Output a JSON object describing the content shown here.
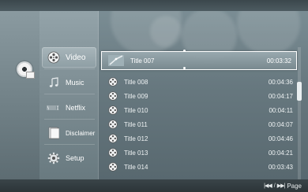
{
  "menu": {
    "items": [
      {
        "label": "Video",
        "icon": "film-reel-icon",
        "active": true
      },
      {
        "label": "Music",
        "icon": "music-note-icon",
        "active": false
      },
      {
        "label": "Netflix",
        "icon": "netflix-logo-icon",
        "active": false
      },
      {
        "label": "Disclaimer",
        "icon": "document-icon",
        "active": false
      },
      {
        "label": "Setup",
        "icon": "gear-icon",
        "active": false
      }
    ]
  },
  "device": {
    "icon": "disc-icon"
  },
  "titles": {
    "selected": {
      "title": "Title 007",
      "time": "00:03:32"
    },
    "rows": [
      {
        "title": "Title 008",
        "time": "00:04:36"
      },
      {
        "title": "Title 009",
        "time": "00:04:17"
      },
      {
        "title": "Title 010",
        "time": "00:04:11"
      },
      {
        "title": "Title 011",
        "time": "00:04:07"
      },
      {
        "title": "Title 012",
        "time": "00:04:46"
      },
      {
        "title": "Title 013",
        "time": "00:04:21"
      },
      {
        "title": "Title 014",
        "time": "00:03:43"
      }
    ]
  },
  "footer": {
    "page_label": "Page"
  },
  "colors": {
    "text": "#ffffff",
    "selection_border": "#ffffff"
  }
}
